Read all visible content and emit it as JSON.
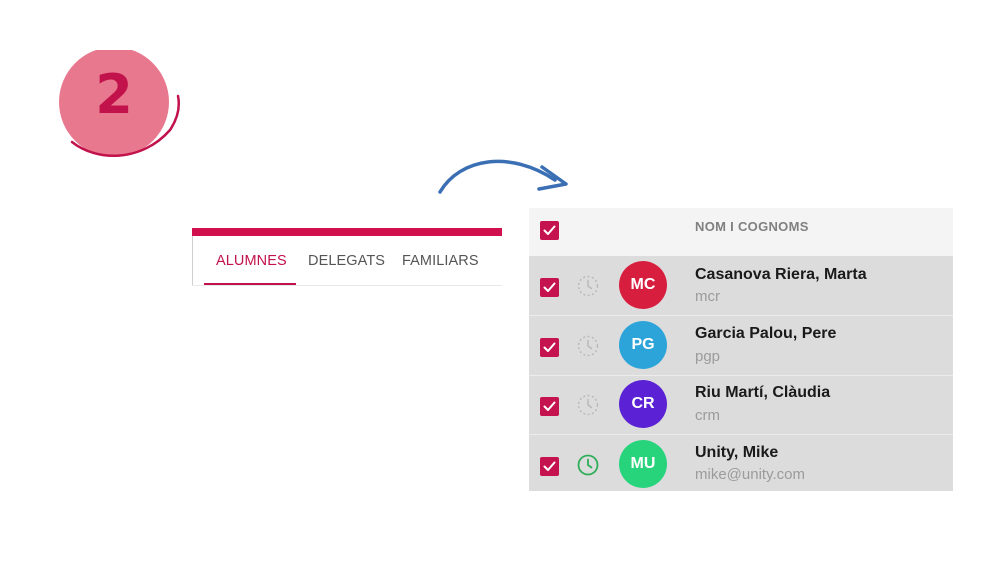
{
  "step": {
    "number": "2",
    "color": "#e8788d",
    "text_color": "#c2124c"
  },
  "tabs": {
    "accent": "#d0104f",
    "items": [
      {
        "label": "ALUMNES",
        "active": true
      },
      {
        "label": "DELEGATS",
        "active": false
      },
      {
        "label": "FAMILIARS",
        "active": false
      }
    ]
  },
  "table": {
    "header": {
      "column_name": "NOM I COGNOMS",
      "select_all_checked": true
    },
    "rows": [
      {
        "checked": true,
        "clock_active": false,
        "initials": "MC",
        "avatar_color": "#d81e3f",
        "name": "Casanova Riera, Marta",
        "login": "mcr"
      },
      {
        "checked": true,
        "clock_active": false,
        "initials": "PG",
        "avatar_color": "#2ca4da",
        "name": "Garcia Palou, Pere",
        "login": "pgp"
      },
      {
        "checked": true,
        "clock_active": false,
        "initials": "CR",
        "avatar_color": "#5a22d4",
        "name": "Riu Martí, Clàudia",
        "login": "crm"
      },
      {
        "checked": true,
        "clock_active": true,
        "initials": "MU",
        "avatar_color": "#27d47c",
        "name": "Unity, Mike",
        "login": "mike@unity.com"
      }
    ]
  }
}
